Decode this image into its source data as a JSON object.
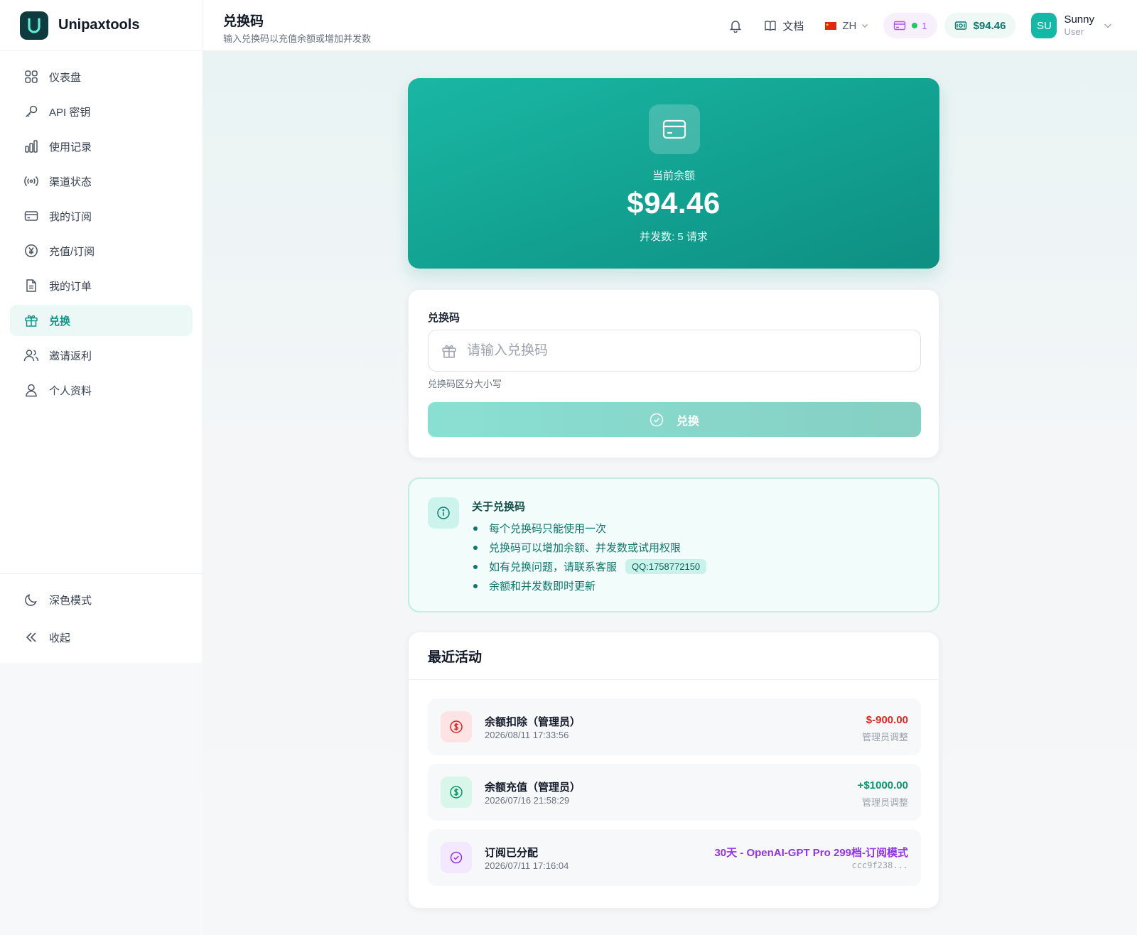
{
  "brand": {
    "name": "Unipaxtools"
  },
  "sidebar": {
    "items": [
      {
        "label": "仪表盘",
        "icon": "grid-icon"
      },
      {
        "label": "API 密钥",
        "icon": "key-icon"
      },
      {
        "label": "使用记录",
        "icon": "bar-chart-icon"
      },
      {
        "label": "渠道状态",
        "icon": "broadcast-icon"
      },
      {
        "label": "我的订阅",
        "icon": "credit-card-icon"
      },
      {
        "label": "充值/订阅",
        "icon": "yen-icon"
      },
      {
        "label": "我的订单",
        "icon": "document-icon"
      },
      {
        "label": "兑换",
        "icon": "gift-icon",
        "active": true
      },
      {
        "label": "邀请返利",
        "icon": "users-icon"
      },
      {
        "label": "个人资料",
        "icon": "user-icon"
      }
    ],
    "bottom": {
      "dark_mode": "深色模式",
      "collapse": "收起"
    }
  },
  "header": {
    "title": "兑换码",
    "subtitle": "输入兑换码以充值余额或增加并发数",
    "docs_label": "文档",
    "language": "ZH",
    "subscription_count": "1",
    "balance": "$94.46",
    "user": {
      "initials": "SU",
      "name": "Sunny",
      "role": "User"
    }
  },
  "balance_card": {
    "label": "当前余额",
    "amount": "$94.46",
    "concurrency": "并发数: 5 请求"
  },
  "redeem": {
    "field_label": "兑换码",
    "placeholder": "请输入兑换码",
    "value": "",
    "hint": "兑换码区分大小写",
    "button": "兑换"
  },
  "info": {
    "title": "关于兑换码",
    "items": [
      "每个兑换码只能使用一次",
      "兑换码可以增加余额、并发数或试用权限",
      "如有兑换问题，请联系客服",
      "余额和并发数即时更新"
    ],
    "qq_badge": "QQ:1758772150"
  },
  "activity": {
    "title": "最近活动",
    "items": [
      {
        "name": "余额扣除（管理员）",
        "time": "2026/08/11 17:33:56",
        "amount": "$-900.00",
        "note": "管理员调整",
        "color": "#dc2626",
        "icon_bg": "#fde3e3"
      },
      {
        "name": "余额充值（管理员）",
        "time": "2026/07/16 21:58:29",
        "amount": "+$1000.00",
        "note": "管理员调整",
        "color": "#059669",
        "icon_bg": "#d9f6ea"
      },
      {
        "name": "订阅已分配",
        "time": "2026/07/11 17:16:04",
        "amount": "30天 - OpenAI-GPT Pro 299档-订阅模式",
        "note": "ccc9f238...",
        "color": "#9333ea",
        "icon_bg": "#f3e8fd"
      }
    ]
  },
  "colors": {
    "accent": "#14b8a6",
    "accent_dark": "#0f9488"
  }
}
